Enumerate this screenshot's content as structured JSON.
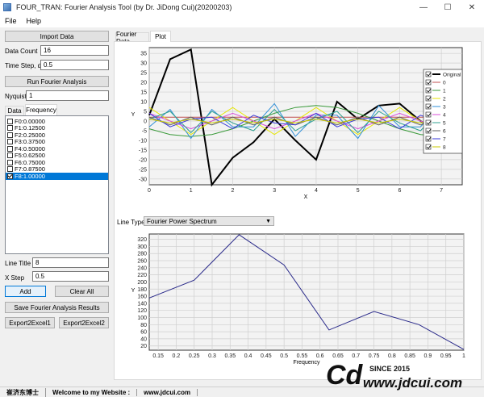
{
  "window": {
    "title": "FOUR_TRAN: Fourier Analysis Tool (by Dr. JiDong Cui)(20200203)",
    "controls": [
      "—",
      "☐",
      "✕"
    ]
  },
  "menu": [
    "File",
    "Help"
  ],
  "left": {
    "import_button": "Import Data",
    "data_count_label": "Data Count",
    "data_count_value": "16",
    "time_step_label": "Time Step, dx",
    "time_step_value": "0.5",
    "run_button": "Run Fourier Analysis",
    "nyquist_label": "Nyquist",
    "nyquist_value": "1",
    "tabs": [
      "Data",
      "Frequency"
    ],
    "frequency_items": [
      {
        "label": "F0:0.00000",
        "checked": false
      },
      {
        "label": "F1:0.12500",
        "checked": false
      },
      {
        "label": "F2:0.25000",
        "checked": false
      },
      {
        "label": "F3:0.37500",
        "checked": false
      },
      {
        "label": "F4:0.50000",
        "checked": false
      },
      {
        "label": "F5:0.62500",
        "checked": false
      },
      {
        "label": "F6:0.75000",
        "checked": false
      },
      {
        "label": "F7:0.87500",
        "checked": false
      },
      {
        "label": "F8:1.00000",
        "checked": true
      }
    ],
    "line_title_label": "Line Title",
    "line_title_value": "8",
    "x_step_label": "X Step",
    "x_step_value": "0.5",
    "add_button": "Add",
    "clear_all_button": "Clear All",
    "save_button": "Save Fourier Analysis Results",
    "export1_button": "Export2Excel1",
    "export2_button": "Export2Excel2"
  },
  "right": {
    "tabs": [
      "Fourier Data",
      "Plot"
    ],
    "line_type_label": "Line Type",
    "line_type_value": "Fourier Power Spectrum"
  },
  "chart_data": [
    {
      "type": "line",
      "xlabel": "X",
      "ylabel": "Y",
      "xlim": [
        0,
        7.5
      ],
      "ylim": [
        -33,
        38
      ],
      "xticks": [
        0,
        1,
        2,
        3,
        4,
        5,
        6,
        7
      ],
      "yticks": [
        35,
        30,
        25,
        20,
        15,
        10,
        5,
        0,
        -5,
        -10,
        -15,
        -20,
        -25,
        -30
      ],
      "grid": true,
      "legend_position": "right",
      "x": [
        0,
        0.5,
        1,
        1.5,
        2,
        2.5,
        3,
        3.5,
        4,
        4.5,
        5,
        5.5,
        6,
        6.5,
        7,
        7.5
      ],
      "series": [
        {
          "name": "Original",
          "color": "#000000",
          "width": 2,
          "values": [
            3,
            32,
            37,
            -33,
            -19,
            -11,
            1,
            -10,
            -20,
            10,
            1,
            8,
            9,
            0,
            -7,
            -2
          ]
        },
        {
          "name": "0",
          "color": "#c05050",
          "width": 1,
          "values": [
            2,
            2,
            2,
            2,
            2,
            2,
            2,
            2,
            2,
            2,
            2,
            2,
            2,
            2,
            2,
            2
          ]
        },
        {
          "name": "1",
          "color": "#3a9a3a",
          "width": 1,
          "values": [
            -4,
            -7,
            -8,
            -7,
            -4,
            0,
            4,
            7,
            8,
            7,
            4,
            0,
            -4,
            -7,
            -8,
            -7
          ]
        },
        {
          "name": "2",
          "color": "#e6e600",
          "width": 1,
          "values": [
            7,
            0,
            -7,
            0,
            7,
            0,
            -7,
            0,
            7,
            0,
            -7,
            0,
            7,
            0,
            -7,
            0
          ]
        },
        {
          "name": "3",
          "color": "#2f8fd8",
          "width": 1,
          "values": [
            -3,
            6,
            -9,
            6,
            -3,
            -3,
            9,
            -8,
            3,
            3,
            -9,
            8,
            -3,
            -3,
            9,
            -8
          ]
        },
        {
          "name": "4",
          "color": "#d84fd8",
          "width": 1,
          "values": [
            4,
            0,
            -4,
            0,
            4,
            0,
            -4,
            0,
            4,
            0,
            -4,
            0,
            4,
            0,
            -4,
            0
          ]
        },
        {
          "name": "5",
          "color": "#30a090",
          "width": 1,
          "values": [
            1,
            5,
            -6,
            5,
            -1,
            -5,
            6,
            -5,
            1,
            5,
            -6,
            5,
            -1,
            -5,
            6,
            -5
          ]
        },
        {
          "name": "6",
          "color": "#606060",
          "width": 1,
          "values": [
            2,
            -2,
            2,
            -2,
            2,
            -2,
            2,
            -2,
            2,
            -2,
            2,
            -2,
            2,
            -2,
            2,
            -2
          ]
        },
        {
          "name": "7",
          "color": "#3a3ad8",
          "width": 1,
          "values": [
            4,
            -3,
            1,
            2,
            -4,
            3,
            -1,
            -2,
            4,
            -3,
            1,
            2,
            -4,
            3,
            -1,
            -2
          ]
        },
        {
          "name": "8",
          "color": "#c8c800",
          "width": 1,
          "values": [
            1,
            -1,
            1,
            -1,
            1,
            -1,
            1,
            -1,
            1,
            -1,
            1,
            -1,
            1,
            -1,
            1,
            -1
          ]
        }
      ]
    },
    {
      "type": "line",
      "xlabel": "Frequency",
      "ylabel": "Y",
      "xlim": [
        0.125,
        1
      ],
      "ylim": [
        8,
        335
      ],
      "xticks": [
        0.15,
        0.2,
        0.25,
        0.3,
        0.35,
        0.4,
        0.45,
        0.5,
        0.55,
        0.6,
        0.65,
        0.7,
        0.75,
        0.8,
        0.85,
        0.9,
        0.95,
        1
      ],
      "yticks": [
        320,
        300,
        280,
        260,
        240,
        220,
        200,
        180,
        160,
        140,
        120,
        100,
        80,
        60,
        40,
        20
      ],
      "grid": true,
      "series": [
        {
          "name": "",
          "color": "#2a2a8a",
          "x": [
            0.125,
            0.25,
            0.375,
            0.5,
            0.625,
            0.75,
            0.875,
            1.0
          ],
          "values": [
            155,
            205,
            333,
            248,
            65,
            117,
            80,
            10
          ]
        }
      ]
    }
  ],
  "status": {
    "author": "崔济东博士",
    "welcome": "Welcome to my Website :",
    "site": "www.jdcui.com",
    "logo_letters": "Cd",
    "since": "SINCE 2015",
    "logo_site": "www.jdcui.com"
  }
}
